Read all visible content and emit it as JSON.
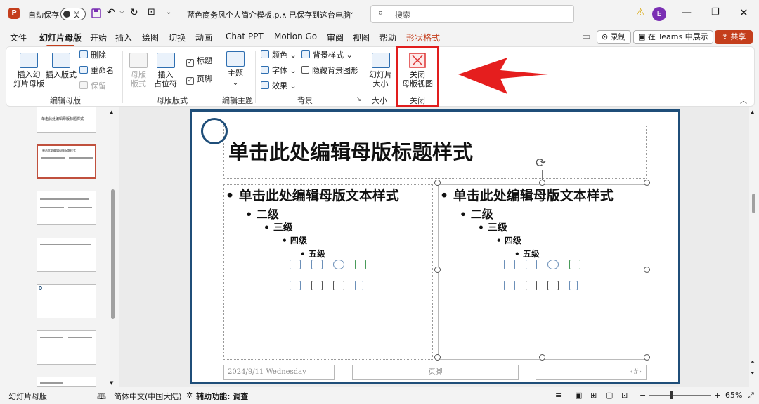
{
  "titlebar": {
    "autosave_label": "自动保存",
    "toggle_state": "关",
    "doc_title": "蓝色商务风个人简介模板.p...",
    "save_status": "• 已保存到这台电脑",
    "search_placeholder": "搜索",
    "avatar_letter": "E"
  },
  "menu": {
    "tabs": [
      "文件",
      "幻灯片母版",
      "开始",
      "插入",
      "绘图",
      "切换",
      "动画",
      "Chat PPT",
      "Motion Go",
      "审阅",
      "视图",
      "帮助",
      "形状格式"
    ],
    "record_label": "录制",
    "teams_label": "在 Teams 中展示",
    "share_label": "共享"
  },
  "ribbon": {
    "insert_master": "插入幻\n灯片母版",
    "insert_layout": "插入版式",
    "delete": "删除",
    "rename": "重命名",
    "preserve": "保留",
    "group_edit_master": "编辑母版",
    "master_layout": "母版\n版式",
    "insert_placeholder": "插入\n占位符",
    "title_cb": "标题",
    "footer_cb": "页脚",
    "group_master_layout": "母版版式",
    "theme": "主题",
    "group_edit_theme": "编辑主题",
    "colors": "颜色",
    "fonts": "字体",
    "effects": "效果",
    "bg_styles": "背景样式",
    "hide_bg": "隐藏背景图形",
    "group_background": "背景",
    "slide_size": "幻灯片\n大小",
    "group_size": "大小",
    "close_master": "关闭\n母版视图",
    "group_close": "关闭"
  },
  "slide": {
    "title": "单击此处编辑母版标题样式",
    "left_body": [
      "• 单击此处编辑母版文本样式",
      "• 二级",
      "• 三级",
      "• 四级",
      "• 五级"
    ],
    "right_body": [
      "• 单击此处编辑母版文本样式",
      "• 二级",
      "• 三级",
      "• 四级",
      "• 五级"
    ],
    "footer_date": "2024/9/11 Wednesday",
    "footer_text": "页脚",
    "footer_page": "‹#›"
  },
  "thumbs": {
    "title_master_text": "单击此处编辑母版标题样式"
  },
  "statusbar": {
    "view": "幻灯片母版",
    "language": "简体中文(中国大陆)",
    "accessibility": "辅助功能: 调查",
    "zoom": "65%"
  },
  "colors": {
    "accent": "#c43e1c",
    "slide_border": "#1f4e79",
    "highlight": "#e11d1d"
  }
}
